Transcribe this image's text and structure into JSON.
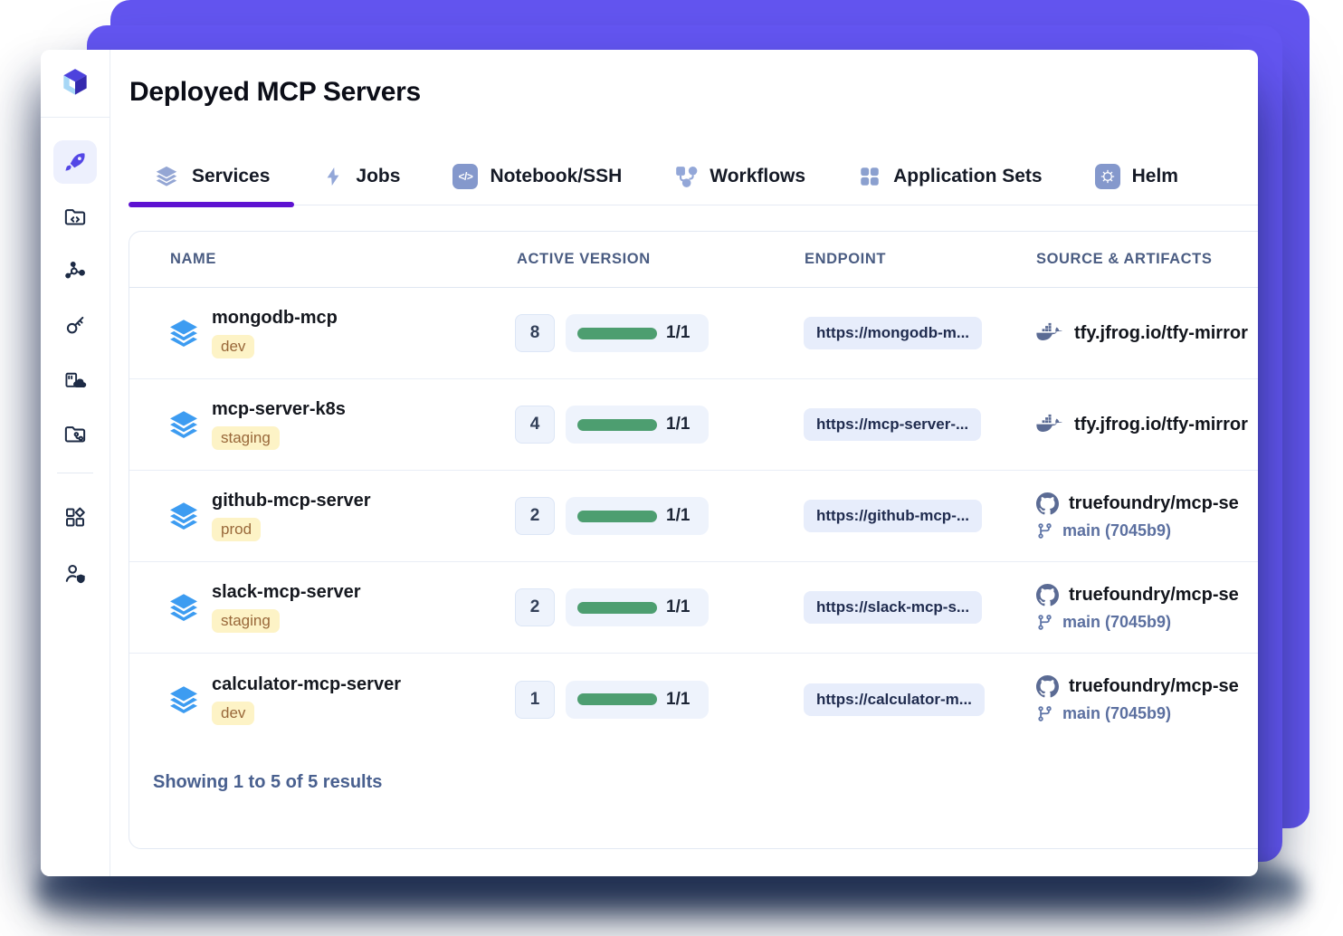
{
  "page": {
    "title": "Deployed MCP Servers"
  },
  "colors": {
    "accent_purple": "#6355f0",
    "active_tab_underline": "#5e12d1",
    "progress_green": "#4d9e70",
    "env_badge_bg": "#fdf3c6",
    "env_badge_text": "#99683a",
    "service_icon_blue": "#3d9cf1"
  },
  "sidebar": {
    "items": [
      {
        "name": "deployments-rocket",
        "active": true
      },
      {
        "name": "code-repositories"
      },
      {
        "name": "ml-network"
      },
      {
        "name": "secrets-key"
      },
      {
        "name": "cloud-integrations"
      },
      {
        "name": "repo-pipelines"
      },
      {
        "name": "applications-grid"
      },
      {
        "name": "user-access"
      }
    ]
  },
  "tabs": [
    {
      "label": "Services",
      "active": true
    },
    {
      "label": "Jobs",
      "active": false
    },
    {
      "label": "Notebook/SSH",
      "active": false
    },
    {
      "label": "Workflows",
      "active": false
    },
    {
      "label": "Application Sets",
      "active": false
    },
    {
      "label": "Helm",
      "active": false
    }
  ],
  "table": {
    "columns": [
      "NAME",
      "ACTIVE VERSION",
      "ENDPOINT",
      "SOURCE & ARTIFACTS"
    ],
    "rows": [
      {
        "name": "mongodb-mcp",
        "env": "dev",
        "version": "8",
        "replicas": "1/1",
        "endpoint": "https://mongodb-m...",
        "source_type": "docker",
        "source": "tfy.jfrog.io/tfy-mirror",
        "branch": ""
      },
      {
        "name": "mcp-server-k8s",
        "env": "staging",
        "version": "4",
        "replicas": "1/1",
        "endpoint": "https://mcp-server-...",
        "source_type": "docker",
        "source": "tfy.jfrog.io/tfy-mirror",
        "branch": ""
      },
      {
        "name": "github-mcp-server",
        "env": "prod",
        "version": "2",
        "replicas": "1/1",
        "endpoint": "https://github-mcp-...",
        "source_type": "github",
        "source": "truefoundry/mcp-se",
        "branch": "main (7045b9)"
      },
      {
        "name": "slack-mcp-server",
        "env": "staging",
        "version": "2",
        "replicas": "1/1",
        "endpoint": "https://slack-mcp-s...",
        "source_type": "github",
        "source": "truefoundry/mcp-se",
        "branch": "main (7045b9)"
      },
      {
        "name": "calculator-mcp-server",
        "env": "dev",
        "version": "1",
        "replicas": "1/1",
        "endpoint": "https://calculator-m...",
        "source_type": "github",
        "source": "truefoundry/mcp-se",
        "branch": "main (7045b9)"
      }
    ],
    "footer": "Showing 1 to 5 of 5 results"
  }
}
